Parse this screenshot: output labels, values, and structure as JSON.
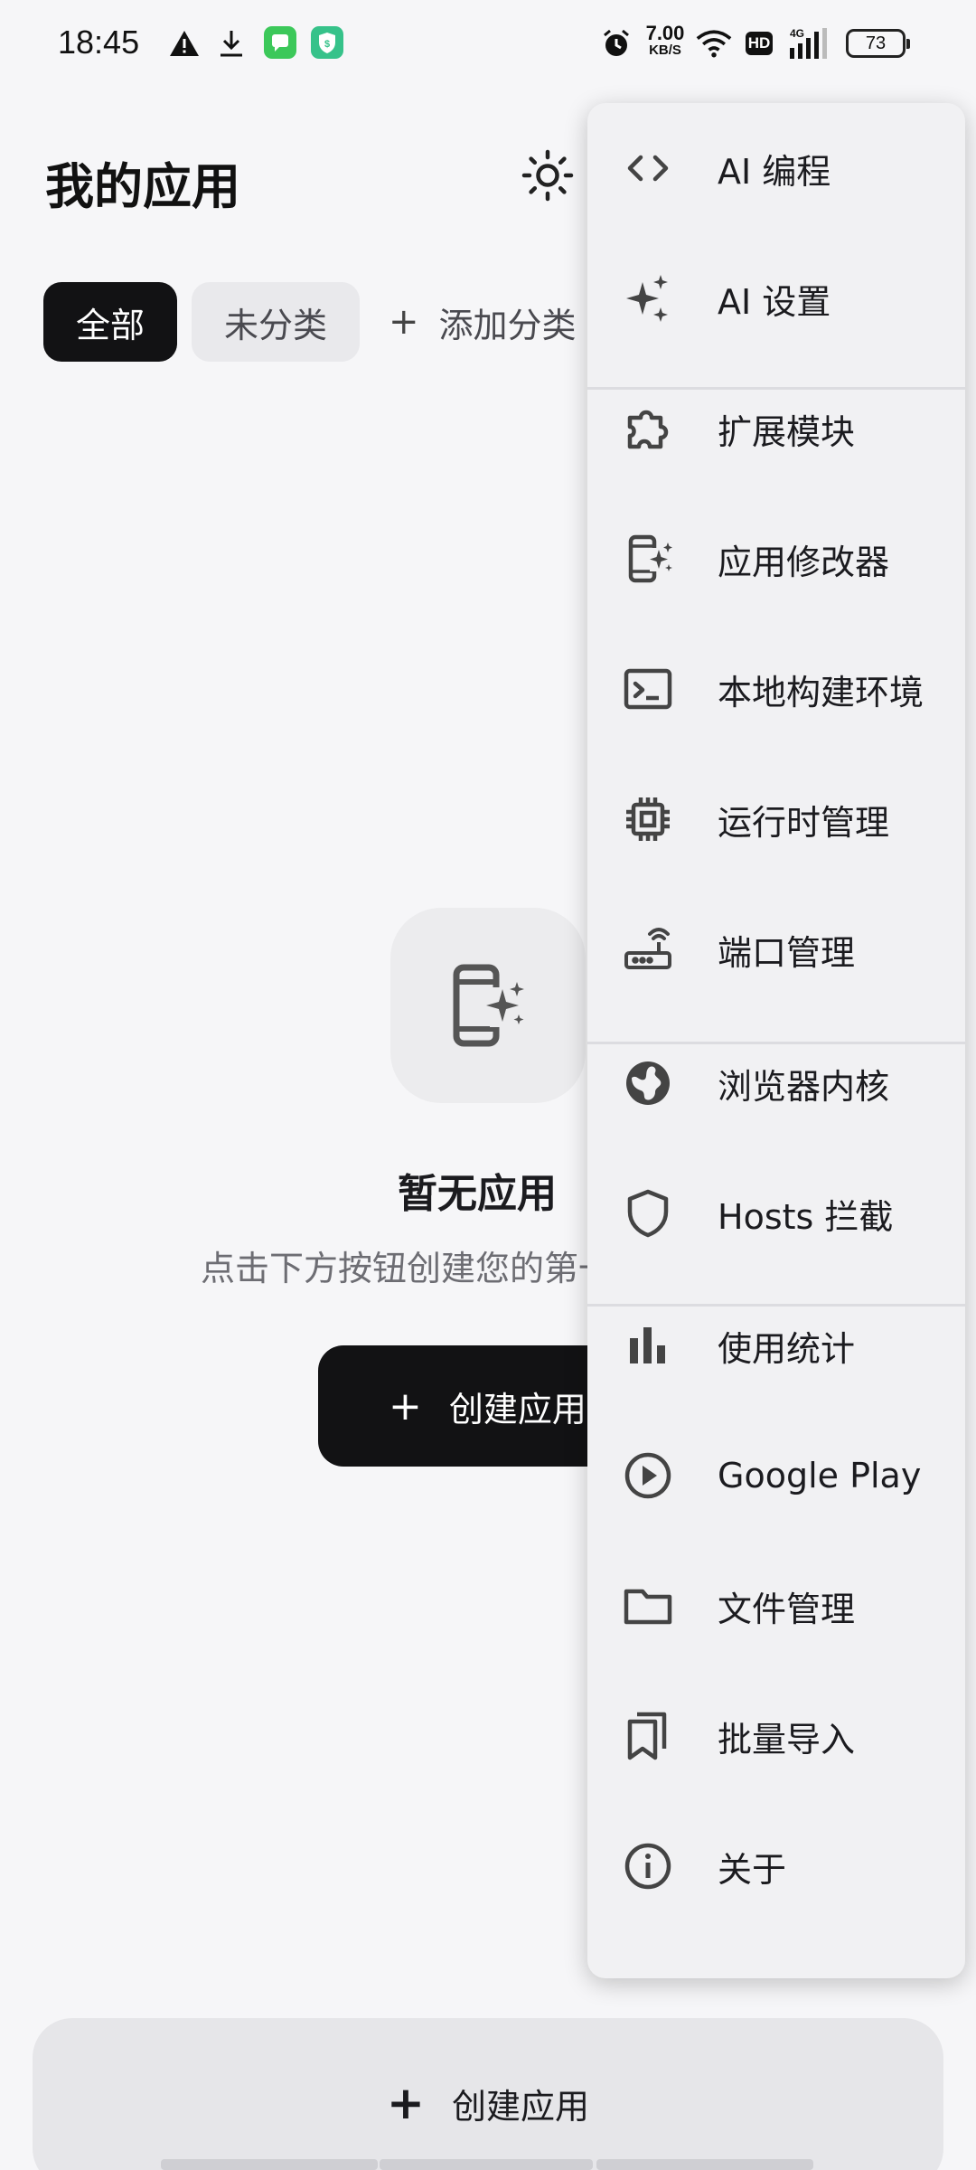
{
  "status_bar": {
    "time": "18:45",
    "net_speed_value": "7.00",
    "net_speed_unit": "KB/S",
    "hd_label": "HD",
    "network_label": "4G",
    "battery": "73",
    "icons": [
      "warning-icon",
      "download-icon",
      "messages-app-icon",
      "shield-app-icon",
      "alarm-icon",
      "wifi-icon",
      "hd-icon",
      "signal-icon",
      "battery-icon"
    ],
    "colors": {
      "messages_app": "#3cc85a",
      "shield_app": "#36c28a"
    }
  },
  "header": {
    "title": "我的应用",
    "theme_icon": "sun-icon"
  },
  "categories": {
    "items": [
      {
        "label": "全部",
        "active": true
      },
      {
        "label": "未分类",
        "active": false
      }
    ],
    "add_label": "添加分类",
    "add_icon": "plus-icon"
  },
  "empty_state": {
    "icon": "app-sparkle-icon",
    "title": "暂无应用",
    "subtitle": "点击下方按钮创建您的第一个应用",
    "button_label": "创建应用",
    "button_icon": "plus-icon"
  },
  "bottom_bar": {
    "create_label": "创建应用",
    "create_icon": "plus-icon"
  },
  "menu": {
    "items": [
      {
        "label": "AI 编程",
        "icon": "code-icon"
      },
      {
        "label": "AI 设置",
        "icon": "sparkles-icon"
      },
      {
        "label": "扩展模块",
        "icon": "puzzle-icon"
      },
      {
        "label": "应用修改器",
        "icon": "app-sparkle-icon"
      },
      {
        "label": "本地构建环境",
        "icon": "terminal-icon"
      },
      {
        "label": "运行时管理",
        "icon": "chip-icon"
      },
      {
        "label": "端口管理",
        "icon": "router-icon"
      },
      {
        "label": "浏览器内核",
        "icon": "globe-icon"
      },
      {
        "label": "Hosts 拦截",
        "icon": "shield-icon"
      },
      {
        "label": "使用统计",
        "icon": "bar-chart-icon"
      },
      {
        "label": "Google Play",
        "icon": "play-circle-icon"
      },
      {
        "label": "文件管理",
        "icon": "folder-icon"
      },
      {
        "label": "批量导入",
        "icon": "bookmarks-icon"
      },
      {
        "label": "关于",
        "icon": "info-icon"
      }
    ]
  },
  "colors": {
    "background": "#f6f6f8",
    "primary_button": "#121214",
    "menu_background": "#f1f1f3",
    "text_primary": "#1b1b1f",
    "text_secondary": "#6d6d73"
  }
}
